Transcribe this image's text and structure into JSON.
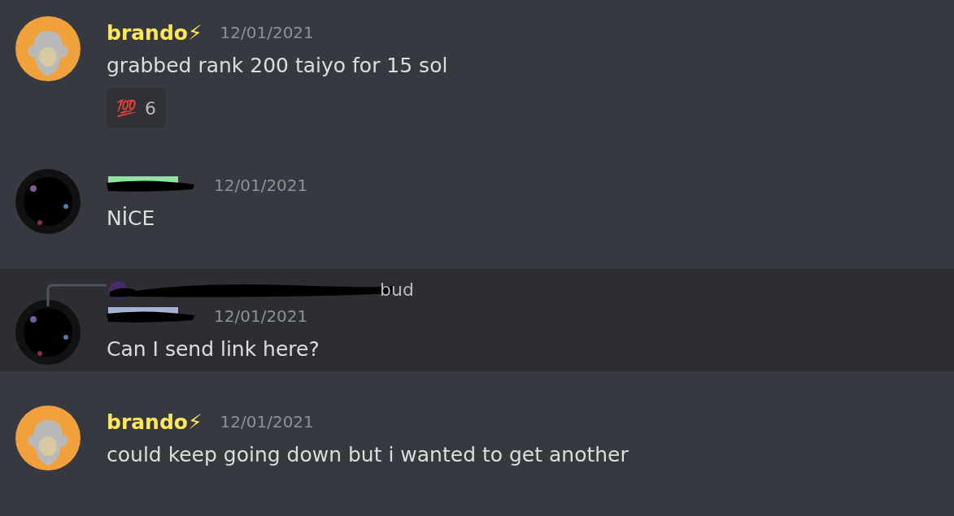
{
  "messages": [
    {
      "avatar": {
        "kind": "monkey"
      },
      "name": "brando⚡",
      "name_redacted": false,
      "color": "#fee75c",
      "timestamp": "12/01/2021",
      "text": "grabbed rank 200 taiyo for 15 sol",
      "highlighted": false,
      "reactions": [
        {
          "emoji": "💯",
          "count": "6"
        }
      ]
    },
    {
      "avatar": {
        "kind": "dark"
      },
      "name_redacted": true,
      "color": "#8fe3a5",
      "timestamp": "12/01/2021",
      "text": "NİCE",
      "highlighted": false
    },
    {
      "avatar": {
        "kind": "dark"
      },
      "name_redacted": true,
      "color": "#a7b4d6",
      "timestamp": "12/01/2021",
      "text": "Can I send link here?",
      "highlighted": true,
      "reply": {
        "visible_text": "bud"
      }
    },
    {
      "avatar": {
        "kind": "monkey"
      },
      "name": "brando⚡",
      "name_redacted": false,
      "color": "#fee75c",
      "timestamp": "12/01/2021",
      "text": "could keep going down but i wanted to get another",
      "highlighted": false
    }
  ]
}
